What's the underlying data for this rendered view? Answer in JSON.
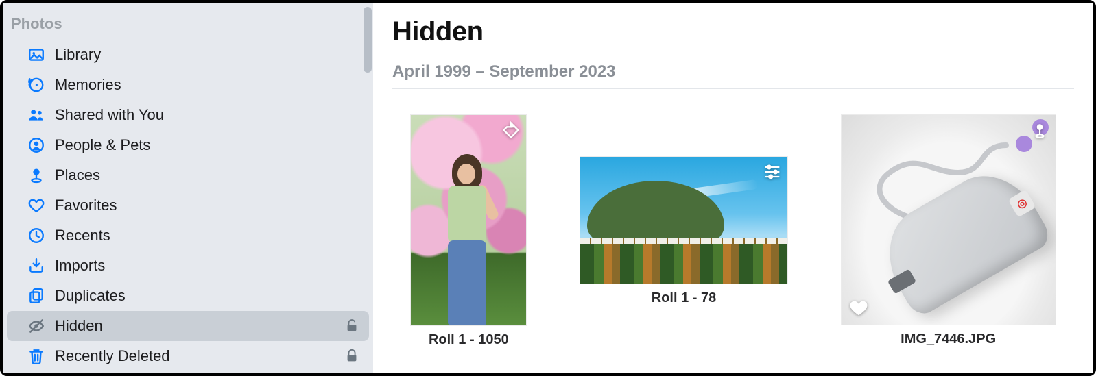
{
  "sidebar": {
    "header": "Photos",
    "items": [
      {
        "icon": "library-icon",
        "label": "Library",
        "selected": false,
        "lock": null
      },
      {
        "icon": "memories-icon",
        "label": "Memories",
        "selected": false,
        "lock": null
      },
      {
        "icon": "shared-icon",
        "label": "Shared with You",
        "selected": false,
        "lock": null
      },
      {
        "icon": "people-icon",
        "label": "People & Pets",
        "selected": false,
        "lock": null
      },
      {
        "icon": "places-icon",
        "label": "Places",
        "selected": false,
        "lock": null
      },
      {
        "icon": "favorites-icon",
        "label": "Favorites",
        "selected": false,
        "lock": null
      },
      {
        "icon": "recents-icon",
        "label": "Recents",
        "selected": false,
        "lock": null
      },
      {
        "icon": "imports-icon",
        "label": "Imports",
        "selected": false,
        "lock": null
      },
      {
        "icon": "duplicates-icon",
        "label": "Duplicates",
        "selected": false,
        "lock": null
      },
      {
        "icon": "hidden-icon",
        "label": "Hidden",
        "selected": true,
        "lock": "unlocked"
      },
      {
        "icon": "trash-icon",
        "label": "Recently Deleted",
        "selected": false,
        "lock": "locked"
      }
    ]
  },
  "main": {
    "title": "Hidden",
    "subtitle": "April 1999 – September 2023",
    "photos": [
      {
        "caption": "Roll 1 - 1050",
        "badges": [
          "tag"
        ],
        "orientation": "portrait"
      },
      {
        "caption": "Roll 1 - 78",
        "badges": [
          "adjustments"
        ],
        "orientation": "landscape"
      },
      {
        "caption": "IMG_7446.JPG",
        "badges": [
          "favorite",
          "location"
        ],
        "orientation": "square"
      }
    ]
  }
}
